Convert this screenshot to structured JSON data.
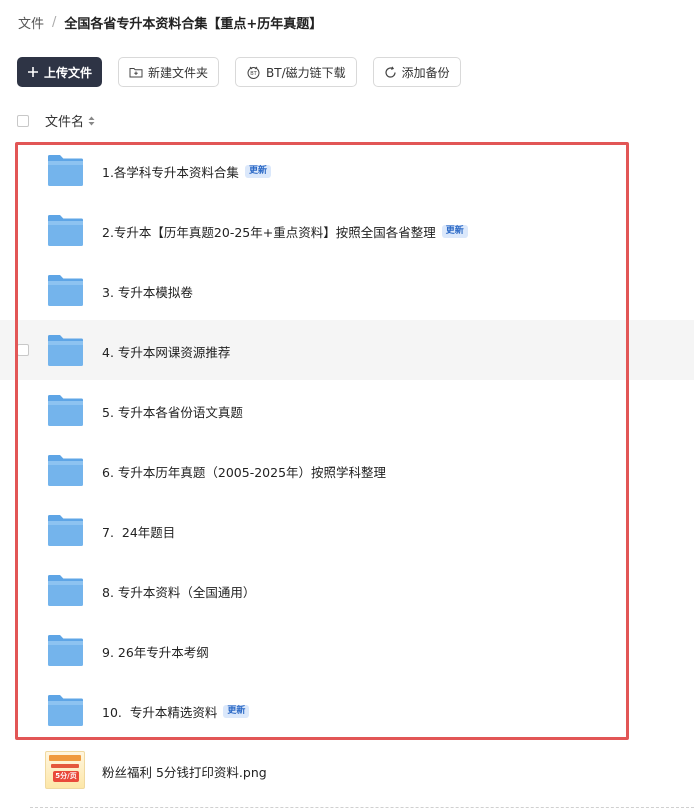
{
  "breadcrumb": {
    "root": "文件",
    "separator": "/",
    "current": "全国各省专升本资料合集【重点+历年真题】"
  },
  "toolbar": {
    "upload": "上传文件",
    "new_folder": "新建文件夹",
    "bt_download": "BT/磁力链下载",
    "add_backup": "添加备份"
  },
  "list_header": {
    "column_name": "文件名"
  },
  "rows": [
    {
      "name": "1.各学科专升本资料合集",
      "badge": "更新"
    },
    {
      "name": "2.专升本【历年真题20-25年+重点资料】按照全国各省整理",
      "badge": "更新"
    },
    {
      "name": "3. 专升本模拟卷",
      "badge": ""
    },
    {
      "name": "4. 专升本网课资源推荐",
      "badge": ""
    },
    {
      "name": "5. 专升本各省份语文真题",
      "badge": ""
    },
    {
      "name": "6. 专升本历年真题（2005-2025年）按照学科整理",
      "badge": ""
    },
    {
      "name": "7.  24年题目",
      "badge": ""
    },
    {
      "name": "8. 专升本资料（全国通用）",
      "badge": ""
    },
    {
      "name": "9. 26年专升本考纲",
      "badge": ""
    },
    {
      "name": "10.  专升本精选资料",
      "badge": "更新"
    }
  ],
  "file": {
    "name": "粉丝福利 5分钱打印资料.png",
    "thumb_text": "5分/页"
  },
  "colors": {
    "primary_button": "#2e3445",
    "folder": "#74b4ec",
    "badge_bg": "#dbe8fb",
    "badge_text": "#2d6ac6",
    "highlight": "#e25656",
    "hover_row": "#f5f5f5"
  }
}
